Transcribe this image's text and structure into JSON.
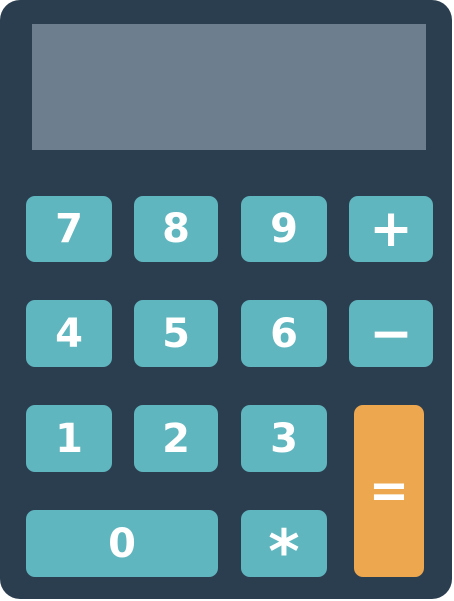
{
  "colors": {
    "body": "#2b3e50",
    "display": "#6d7f8e",
    "key": "#5fb6be",
    "key_text": "#ffffff",
    "equals_key": "#eda74f"
  },
  "keys": {
    "k7": "7",
    "k8": "8",
    "k9": "9",
    "plus": "+",
    "k4": "4",
    "k5": "5",
    "k6": "6",
    "minus": "−",
    "k1": "1",
    "k2": "2",
    "k3": "3",
    "equals": "=",
    "k0": "0",
    "multiply": "*"
  }
}
